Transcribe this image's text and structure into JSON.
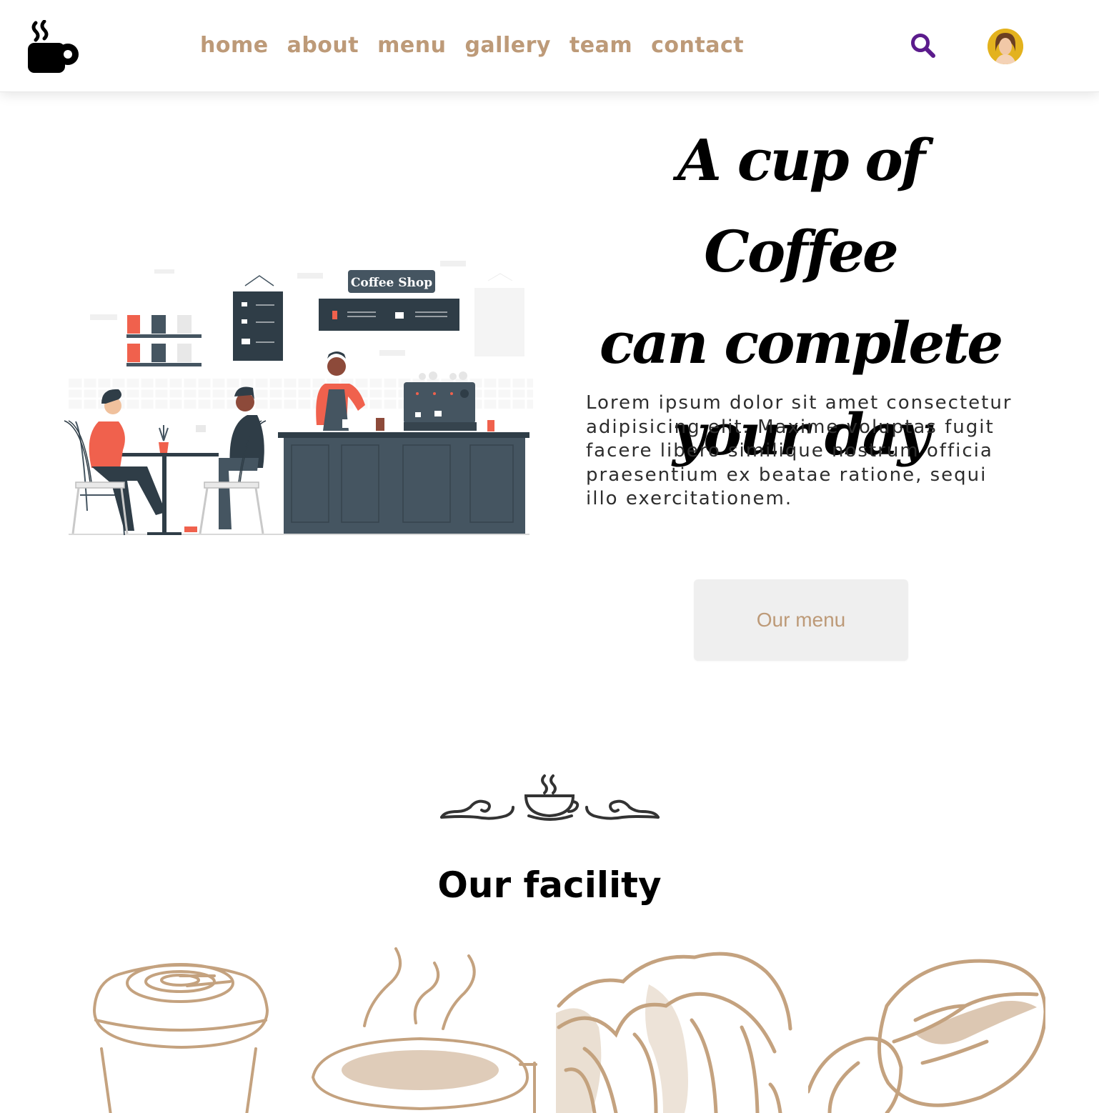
{
  "navbar": {
    "logo_icon": "coffee-mug-icon",
    "links": [
      "home",
      "about",
      "menu",
      "gallery",
      "team",
      "contact"
    ],
    "search_icon": "search-icon",
    "avatar": "user-avatar"
  },
  "hero": {
    "title_lines": [
      "A cup of Coffee",
      "can complete",
      "your day"
    ],
    "text": "Lorem ipsum dolor sit amet consectetur adipisicing elit. Maxime voluptas fugit facere libero similique nostrum officia praesentium ex beatae ratione, sequi illo exercitationem.",
    "button_label": "Our menu",
    "illustration": {
      "sign_label": "Coffee Shop"
    }
  },
  "facility": {
    "divider_icon": "coffee-cup-ornament-icon",
    "title": "Our facility",
    "items": [
      "takeaway-cup-icon",
      "coffee-cup-icon",
      "croissant-icon",
      "coffee-bean-icon"
    ]
  },
  "colors": {
    "accent": "#bd9a78",
    "search": "#5b1b8c",
    "illustration_dark": "#455561",
    "illustration_coral": "#f0614d",
    "button_bg": "#efefef"
  }
}
